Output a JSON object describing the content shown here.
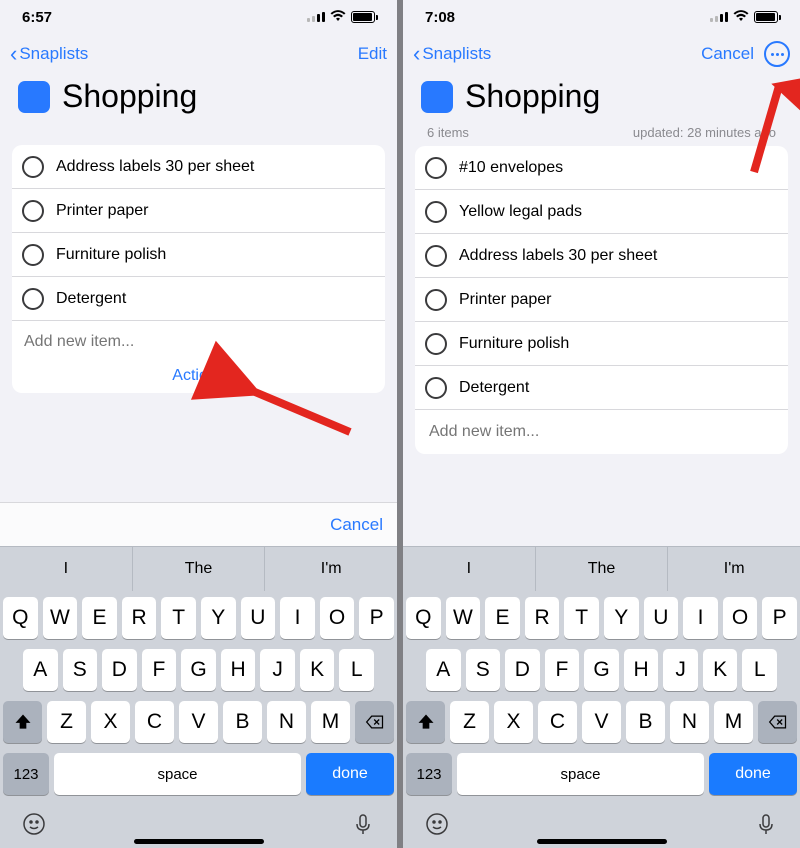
{
  "phone_a": {
    "status_time": "6:57",
    "nav_back_label": "Snaplists",
    "nav_right_label": "Edit",
    "list_title": "Shopping",
    "swatch_color": "#2879ff",
    "items": [
      "Address labels 30 per sheet",
      "Printer paper",
      "Furniture polish",
      "Detergent"
    ],
    "add_placeholder": "Add new item...",
    "actions_label": "Actions",
    "kb_cancel_label": "Cancel"
  },
  "phone_b": {
    "status_time": "7:08",
    "nav_back_label": "Snaplists",
    "nav_right_label": "Cancel",
    "list_title": "Shopping",
    "swatch_color": "#2879ff",
    "meta_count": "6 items",
    "meta_updated": "updated: 28 minutes ago",
    "items": [
      "#10 envelopes",
      "Yellow legal pads",
      "Address labels 30 per sheet",
      "Printer paper",
      "Furniture polish",
      "Detergent"
    ],
    "add_placeholder": "Add new item..."
  },
  "keyboard": {
    "predict": [
      "I",
      "The",
      "I'm"
    ],
    "row1": [
      "Q",
      "W",
      "E",
      "R",
      "T",
      "Y",
      "U",
      "I",
      "O",
      "P"
    ],
    "row2": [
      "A",
      "S",
      "D",
      "F",
      "G",
      "H",
      "J",
      "K",
      "L"
    ],
    "row3": [
      "Z",
      "X",
      "C",
      "V",
      "B",
      "N",
      "M"
    ],
    "nums_label": "123",
    "space_label": "space",
    "done_label": "done"
  }
}
